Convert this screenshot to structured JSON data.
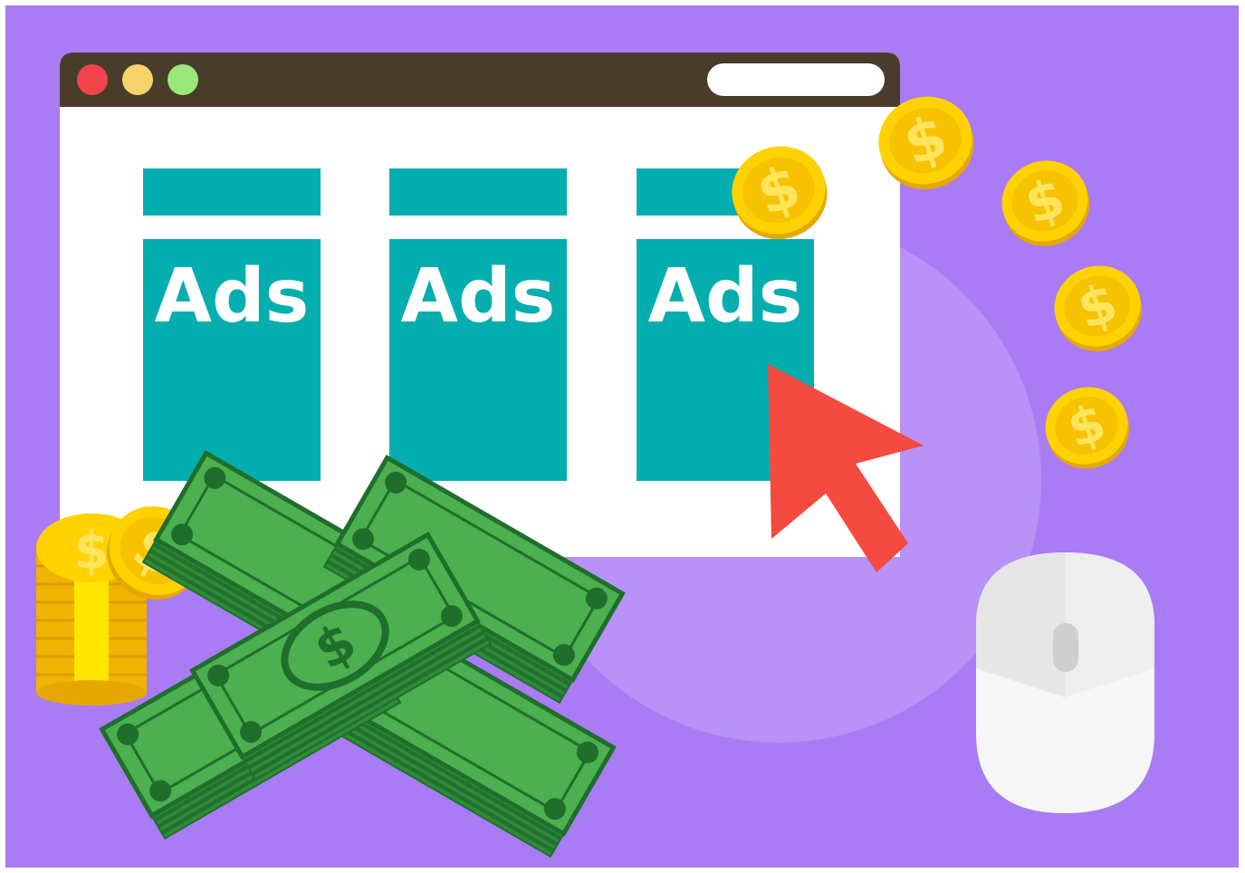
{
  "colors": {
    "background": "#a97bf4",
    "background_circle": "#b892f7",
    "browser_titlebar": "#4a3c2a",
    "browser_body": "#ffffff",
    "window_close": "#f0464b",
    "window_minimize": "#f7d36b",
    "window_maximize": "#9be87a",
    "ad_teal": "#04aeae",
    "cursor_red": "#f44a3f",
    "coin_gold": "#ffd200",
    "coin_rim": "#f0b400",
    "bill_green": "#4caf50",
    "bill_dark": "#1f6e2b",
    "mouse_white": "#f6f6f6",
    "mouse_gray": "#e6e6e6"
  },
  "browser": {
    "window_controls": [
      "close",
      "minimize",
      "maximize"
    ],
    "address_bar_value": "",
    "ads": [
      {
        "label": "Ads"
      },
      {
        "label": "Ads"
      },
      {
        "label": "Ads"
      }
    ]
  },
  "icons": [
    "mouse-pointer-icon",
    "dollar-coin-icon",
    "cash-stack-icon",
    "computer-mouse-icon"
  ]
}
